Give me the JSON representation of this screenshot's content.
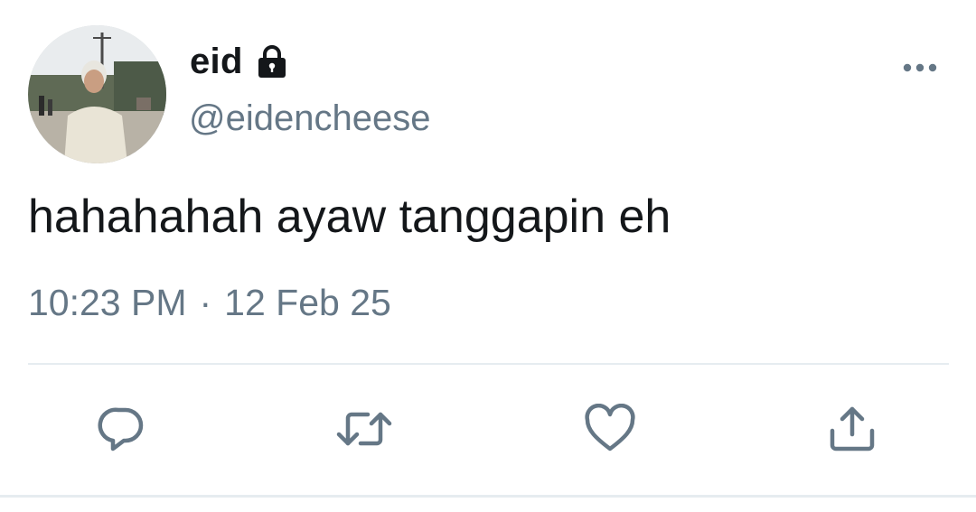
{
  "tweet": {
    "display_name": "eid",
    "handle": "@eidencheese",
    "text": "hahahahah ayaw tanggapin eh",
    "time": "10:23 PM",
    "separator": "·",
    "date": "12 Feb 25"
  },
  "icons": {
    "lock": "lock-icon",
    "more": "more-horizontal-icon",
    "reply": "reply-icon",
    "retweet": "retweet-icon",
    "like": "heart-icon",
    "share": "share-icon"
  },
  "colors": {
    "primary_text": "#14171a",
    "secondary_text": "#657786",
    "divider": "#e6ecf0",
    "icon": "#657786"
  }
}
